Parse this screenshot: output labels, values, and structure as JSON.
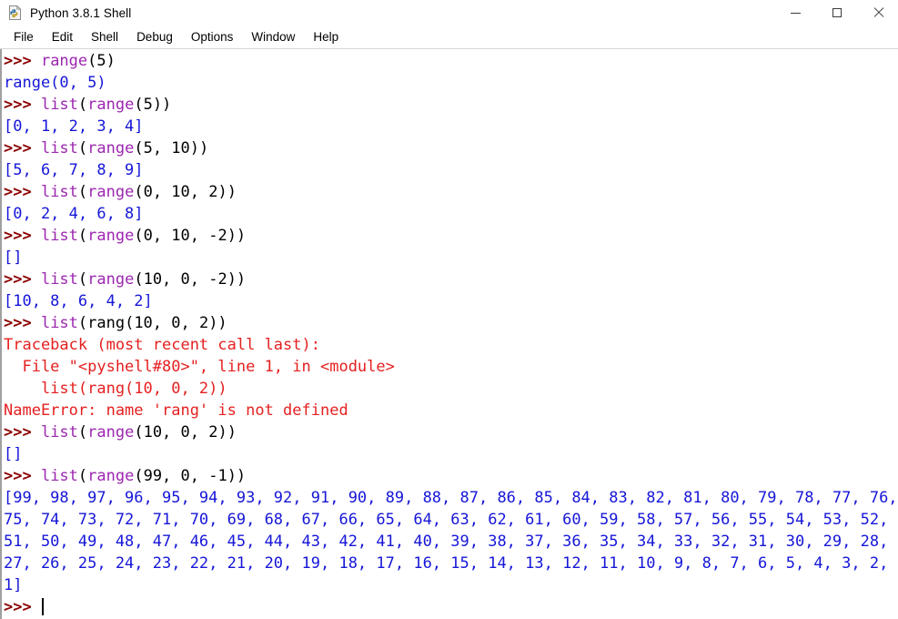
{
  "window": {
    "title": "Python 3.8.1 Shell",
    "icon": "python-file-icon",
    "controls": {
      "minimize": "minimize-icon",
      "maximize": "maximize-icon",
      "close": "close-icon"
    }
  },
  "menubar": {
    "items": [
      {
        "label": "File"
      },
      {
        "label": "Edit"
      },
      {
        "label": "Shell"
      },
      {
        "label": "Debug"
      },
      {
        "label": "Options"
      },
      {
        "label": "Window"
      },
      {
        "label": "Help"
      }
    ]
  },
  "colors": {
    "prompt": "#8b0000",
    "builtin": "#9c27b0",
    "output": "#1616d8",
    "error": "#e52020",
    "code": "#000000",
    "background": "#ffffff"
  },
  "console": {
    "lines": [
      {
        "kind": "input",
        "segments": [
          {
            "t": "prompt",
            "s": ">>> "
          },
          {
            "t": "builtin",
            "s": "range"
          },
          {
            "t": "code",
            "s": "(5)"
          }
        ]
      },
      {
        "kind": "output",
        "segments": [
          {
            "t": "out",
            "s": "range(0, 5)"
          }
        ]
      },
      {
        "kind": "input",
        "segments": [
          {
            "t": "prompt",
            "s": ">>> "
          },
          {
            "t": "builtin",
            "s": "list"
          },
          {
            "t": "code",
            "s": "("
          },
          {
            "t": "builtin",
            "s": "range"
          },
          {
            "t": "code",
            "s": "(5))"
          }
        ]
      },
      {
        "kind": "output",
        "segments": [
          {
            "t": "out",
            "s": "[0, 1, 2, 3, 4]"
          }
        ]
      },
      {
        "kind": "input",
        "segments": [
          {
            "t": "prompt",
            "s": ">>> "
          },
          {
            "t": "builtin",
            "s": "list"
          },
          {
            "t": "code",
            "s": "("
          },
          {
            "t": "builtin",
            "s": "range"
          },
          {
            "t": "code",
            "s": "(5, 10))"
          }
        ]
      },
      {
        "kind": "output",
        "segments": [
          {
            "t": "out",
            "s": "[5, 6, 7, 8, 9]"
          }
        ]
      },
      {
        "kind": "input",
        "segments": [
          {
            "t": "prompt",
            "s": ">>> "
          },
          {
            "t": "builtin",
            "s": "list"
          },
          {
            "t": "code",
            "s": "("
          },
          {
            "t": "builtin",
            "s": "range"
          },
          {
            "t": "code",
            "s": "(0, 10, 2))"
          }
        ]
      },
      {
        "kind": "output",
        "segments": [
          {
            "t": "out",
            "s": "[0, 2, 4, 6, 8]"
          }
        ]
      },
      {
        "kind": "input",
        "segments": [
          {
            "t": "prompt",
            "s": ">>> "
          },
          {
            "t": "builtin",
            "s": "list"
          },
          {
            "t": "code",
            "s": "("
          },
          {
            "t": "builtin",
            "s": "range"
          },
          {
            "t": "code",
            "s": "(0, 10, -2))"
          }
        ]
      },
      {
        "kind": "output",
        "segments": [
          {
            "t": "out",
            "s": "[]"
          }
        ]
      },
      {
        "kind": "input",
        "segments": [
          {
            "t": "prompt",
            "s": ">>> "
          },
          {
            "t": "builtin",
            "s": "list"
          },
          {
            "t": "code",
            "s": "("
          },
          {
            "t": "builtin",
            "s": "range"
          },
          {
            "t": "code",
            "s": "(10, 0, -2))"
          }
        ]
      },
      {
        "kind": "output",
        "segments": [
          {
            "t": "out",
            "s": "[10, 8, 6, 4, 2]"
          }
        ]
      },
      {
        "kind": "input",
        "segments": [
          {
            "t": "prompt",
            "s": ">>> "
          },
          {
            "t": "builtin",
            "s": "list"
          },
          {
            "t": "code",
            "s": "(rang(10, 0, 2))"
          }
        ]
      },
      {
        "kind": "error",
        "segments": [
          {
            "t": "err",
            "s": "Traceback (most recent call last):"
          }
        ]
      },
      {
        "kind": "error",
        "segments": [
          {
            "t": "err",
            "s": "  File \"<pyshell#80>\", line 1, in <module>"
          }
        ]
      },
      {
        "kind": "error",
        "segments": [
          {
            "t": "err",
            "s": "    list(rang(10, 0, 2))"
          }
        ]
      },
      {
        "kind": "error",
        "segments": [
          {
            "t": "err",
            "s": "NameError: name 'rang' is not defined"
          }
        ]
      },
      {
        "kind": "input",
        "segments": [
          {
            "t": "prompt",
            "s": ">>> "
          },
          {
            "t": "builtin",
            "s": "list"
          },
          {
            "t": "code",
            "s": "("
          },
          {
            "t": "builtin",
            "s": "range"
          },
          {
            "t": "code",
            "s": "(10, 0, 2))"
          }
        ]
      },
      {
        "kind": "output",
        "segments": [
          {
            "t": "out",
            "s": "[]"
          }
        ]
      },
      {
        "kind": "input",
        "segments": [
          {
            "t": "prompt",
            "s": ">>> "
          },
          {
            "t": "builtin",
            "s": "list"
          },
          {
            "t": "code",
            "s": "("
          },
          {
            "t": "builtin",
            "s": "range"
          },
          {
            "t": "code",
            "s": "(99, 0, -1))"
          }
        ]
      },
      {
        "kind": "output-wrapped",
        "segments": [
          {
            "t": "out",
            "s": "[99, 98, 97, 96, 95, 94, 93, 92, 91, 90, 89, 88, 87, 86, 85, 84, 83, 82, 81, 80, 79, 78, 77, 76, 75, 74, 73, 72, 71, 70, 69, 68, 67, 66, 65, 64, 63, 62, 61, 60, 59, 58, 57, 56, 55, 54, 53, 52, 51, 50, 49, 48, 47, 46, 45, 44, 43, 42, 41, 40, 39, 38, 37, 36, 35, 34, 33, 32, 31, 30, 29, 28, 27, 26, 25, 24, 23, 22, 21, 20, 19, 18, 17, 16, 15, 14, 13, 12, 11, 10, 9, 8, 7, 6, 5, 4, 3, 2, 1]"
          }
        ]
      },
      {
        "kind": "prompt-cursor",
        "segments": [
          {
            "t": "prompt",
            "s": ">>> "
          }
        ]
      }
    ],
    "range_output_values": [
      99,
      98,
      97,
      96,
      95,
      94,
      93,
      92,
      91,
      90,
      89,
      88,
      87,
      86,
      85,
      84,
      83,
      82,
      81,
      80,
      79,
      78,
      77,
      76,
      75,
      74,
      73,
      72,
      71,
      70,
      69,
      68,
      67,
      66,
      65,
      64,
      63,
      62,
      61,
      60,
      59,
      58,
      57,
      56,
      55,
      54,
      53,
      52,
      51,
      50,
      49,
      48,
      47,
      46,
      45,
      44,
      43,
      42,
      41,
      40,
      39,
      38,
      37,
      36,
      35,
      34,
      33,
      32,
      31,
      30,
      29,
      28,
      27,
      26,
      25,
      24,
      23,
      22,
      21,
      20,
      19,
      18,
      17,
      16,
      15,
      14,
      13,
      12,
      11,
      10,
      9,
      8,
      7,
      6,
      5,
      4,
      3,
      2,
      1
    ]
  }
}
